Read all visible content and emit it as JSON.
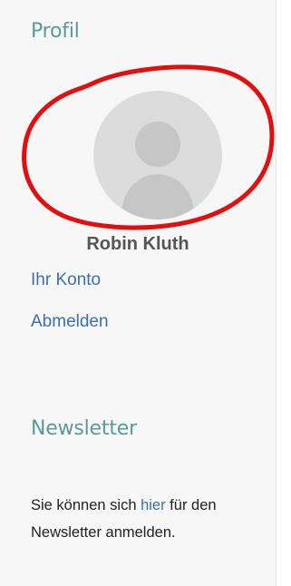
{
  "profile": {
    "heading": "Profil",
    "avatar_icon": "user-avatar-icon",
    "name": "Robin Kluth",
    "links": {
      "account": "Ihr Konto",
      "logout": "Abmelden"
    }
  },
  "newsletter": {
    "heading": "Newsletter",
    "text_before": "Sie können sich ",
    "link_text": "hier",
    "text_after": " für den Newsletter anmelden."
  },
  "colors": {
    "heading": "#5b9a9a",
    "link": "#3c6fb0",
    "annotation": "#e01010"
  }
}
